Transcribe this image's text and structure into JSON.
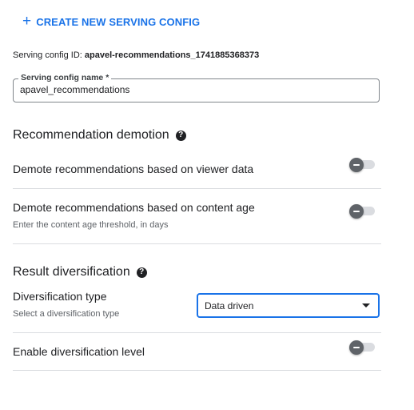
{
  "create_button": {
    "label": "CREATE NEW SERVING CONFIG",
    "icon": "plus-icon"
  },
  "serving_config": {
    "id_label": "Serving config ID:",
    "id_value": "apavel-recommendations_1741885368373"
  },
  "name_field": {
    "label": "Serving config name *",
    "value": "apavel_recommendations"
  },
  "demotion": {
    "title": "Recommendation demotion",
    "help_icon": "help-circle-icon",
    "rows": [
      {
        "label": "Demote recommendations based on viewer data",
        "sublabel": "",
        "enabled": false
      },
      {
        "label": "Demote recommendations based on content age",
        "sublabel": "Enter the content age threshold, in days",
        "enabled": false
      }
    ]
  },
  "diversification": {
    "title": "Result diversification",
    "help_icon": "help-circle-icon",
    "type_label": "Diversification type",
    "type_sublabel": "Select a diversification type",
    "type_value": "Data driven",
    "level_label": "Enable diversification level",
    "level_enabled": false
  },
  "colors": {
    "accent": "#1a73e8",
    "toggle_thumb_off": "#5f6368",
    "toggle_track_off": "#dadce0",
    "divider": "#dadce0"
  }
}
